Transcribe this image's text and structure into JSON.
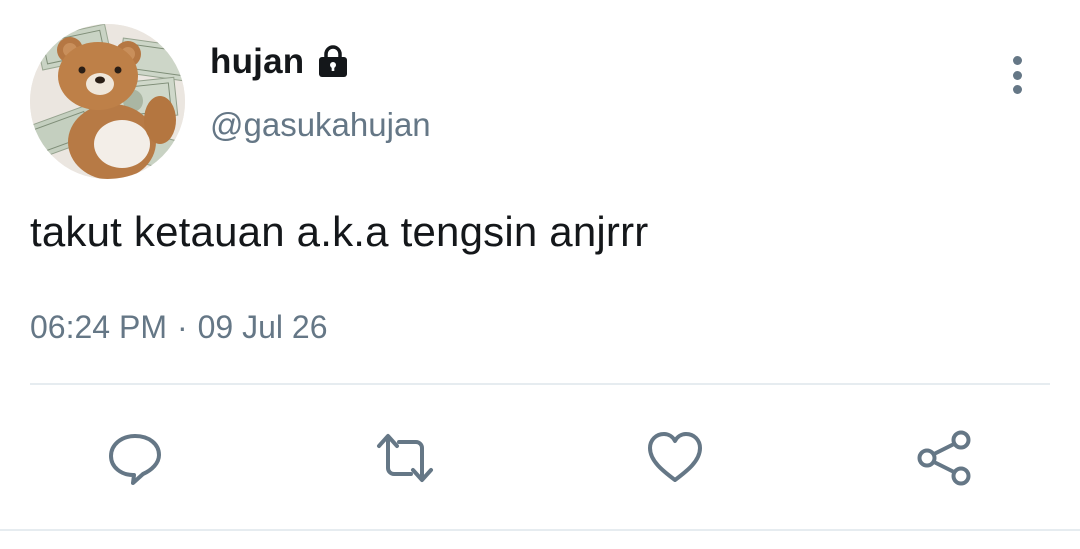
{
  "user": {
    "display_name": "hujan",
    "handle": "@gasukahujan",
    "protected_icon": "lock-icon",
    "avatar": "teddy-bear-with-dollar-bills"
  },
  "tweet": {
    "text": "takut ketauan a.k.a tengsin anjrrr",
    "time": "06:24 PM",
    "separator": "·",
    "date": "09 Jul 26"
  },
  "actions": [
    {
      "name": "reply",
      "icon": "comment-icon"
    },
    {
      "name": "retweet",
      "icon": "retweet-icon"
    },
    {
      "name": "like",
      "icon": "heart-icon"
    },
    {
      "name": "share",
      "icon": "share-icon"
    }
  ],
  "menu": {
    "icon": "vertical-ellipsis-icon"
  },
  "colors": {
    "text_primary": "#14171a",
    "text_secondary": "#657786",
    "divider": "#e6ecf0"
  }
}
